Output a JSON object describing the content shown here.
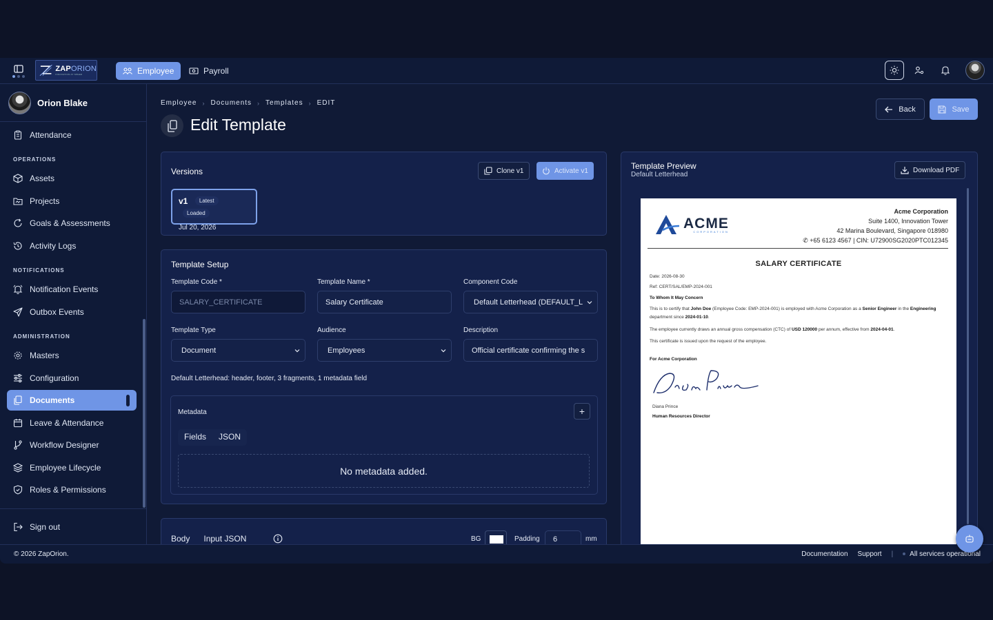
{
  "topnav": {
    "logo_main": "ZAP",
    "logo_accent": "ORION",
    "logo_tagline": "INNOVATION AT SPEED",
    "tabs": [
      {
        "label": "Employee",
        "active": true
      },
      {
        "label": "Payroll",
        "active": false
      }
    ]
  },
  "sidebar": {
    "user_name": "Orion Blake",
    "items": {
      "attendance": "Attendance",
      "assets": "Assets",
      "projects": "Projects",
      "goals": "Goals & Assessments",
      "activity": "Activity Logs",
      "notification_events": "Notification Events",
      "outbox_events": "Outbox Events",
      "masters": "Masters",
      "configuration": "Configuration",
      "documents": "Documents",
      "leave": "Leave & Attendance",
      "workflow": "Workflow Designer",
      "lifecycle": "Employee Lifecycle",
      "roles": "Roles & Permissions",
      "signout": "Sign out"
    },
    "sections": {
      "operations": "OPERATIONS",
      "notifications": "NOTIFICATIONS",
      "administration": "ADMINISTRATION"
    }
  },
  "breadcrumb": [
    "Employee",
    "Documents",
    "Templates",
    "EDIT"
  ],
  "page": {
    "title": "Edit Template",
    "back_label": "Back",
    "save_label": "Save"
  },
  "versions": {
    "title": "Versions",
    "clone_label": "Clone v1",
    "activate_label": "Activate v1",
    "version": "v1",
    "tag_latest": "Latest",
    "tag_loaded": "Loaded",
    "date": "Jul 20, 2026"
  },
  "setup": {
    "title": "Template Setup",
    "code_label": "Template Code *",
    "code_value": "SALARY_CERTIFICATE",
    "name_label": "Template Name *",
    "name_value": "Salary Certificate",
    "component_label": "Component Code",
    "component_value": "Default Letterhead (DEFAULT_L",
    "type_label": "Template Type",
    "type_value": "Document",
    "audience_label": "Audience",
    "audience_value": "Employees",
    "desc_label": "Description",
    "desc_value": "Official certificate confirming the s",
    "summary": "Default Letterhead: header, footer, 3 fragments, 1 metadata field",
    "metadata_title": "Metadata",
    "tab_fields": "Fields",
    "tab_json": "JSON",
    "empty": "No metadata added."
  },
  "body_card": {
    "tab_body": "Body",
    "tab_input": "Input JSON",
    "bg_label": "BG",
    "padding_label": "Padding",
    "padding_value": "6",
    "unit": "mm"
  },
  "preview": {
    "title": "Template Preview",
    "subtitle": "Default Letterhead",
    "download_label": "Download PDF",
    "logo_text": "ACME",
    "logo_sub": "CORPORATION",
    "company": "Acme Corporation",
    "addr1": "Suite 1400, Innovation Tower",
    "addr2": "42 Marina Boulevard, Singapore 018980",
    "contact": "+65 6123 4567 | CIN: U72900SG2020PTC012345",
    "heading": "SALARY CERTIFICATE",
    "date": "Date: 2026-08-30",
    "ref": "Ref: CERT/SAL/EMP-2024-001",
    "salutation": "To Whom It May Concern",
    "para1_a": "This is to certify that ",
    "para1_name": "John Doe",
    "para1_b": " (Employee Code: EMP-2024-001) is employed with Acme Corporation as a ",
    "para1_role": "Senior Engineer",
    "para1_c": " in the ",
    "para1_dept": "Engineering",
    "para1_d": " department since ",
    "para1_since": "2024-01-10",
    "para1_e": ".",
    "para2_a": "The employee currently draws an annual gross compensation (CTC) of ",
    "para2_amount": "USD 120000",
    "para2_b": " per annum, effective from ",
    "para2_date": "2024-04-01",
    "para2_c": ".",
    "para3": "This certificate is issued upon the request of the employee.",
    "for_company": "For Acme Corporation",
    "signature": "Diana Prince",
    "signer": "Diana Prince",
    "signer_title": "Human Resources Director"
  },
  "footer": {
    "copyright": "© 2026 ZapOrion.",
    "docs": "Documentation",
    "support": "Support",
    "status": "All services operational"
  }
}
